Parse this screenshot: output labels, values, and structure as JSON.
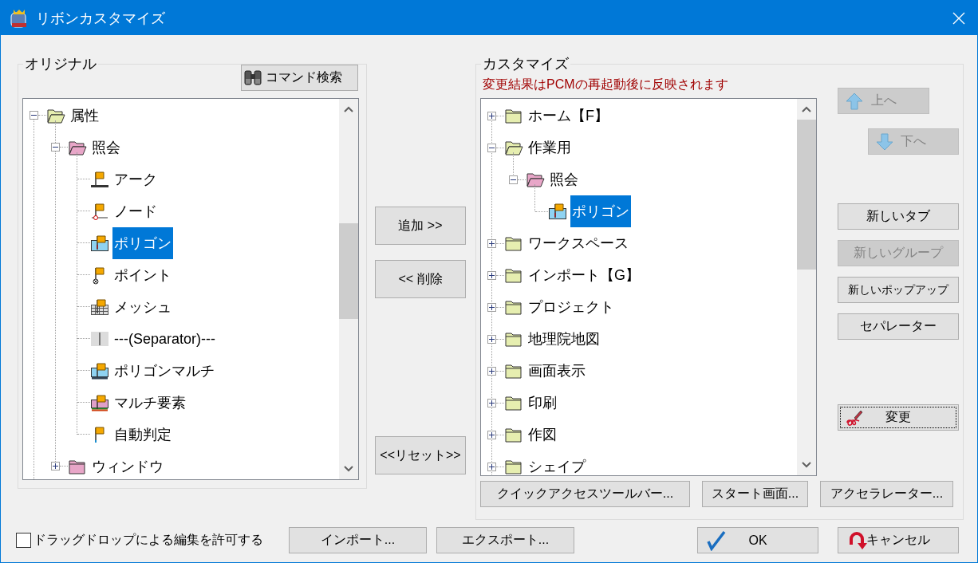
{
  "window": {
    "title": "リボンカスタマイズ"
  },
  "original": {
    "title": "オリジナル",
    "search_button": "コマンド検索",
    "tree": [
      {
        "label": "属性",
        "kind": "folder",
        "color": "#e6eeb0",
        "expanded": true,
        "selected": false,
        "children": [
          {
            "label": "照会",
            "kind": "folder",
            "color": "#e8a6c8",
            "expanded": true,
            "selected": false,
            "children": [
              {
                "label": "アーク",
                "kind": "arc",
                "selected": false
              },
              {
                "label": "ノード",
                "kind": "node",
                "selected": false
              },
              {
                "label": "ポリゴン",
                "kind": "polygon",
                "selected": true
              },
              {
                "label": "ポイント",
                "kind": "point",
                "selected": false
              },
              {
                "label": "メッシュ",
                "kind": "mesh",
                "selected": false
              },
              {
                "label": "---(Separator)---",
                "kind": "separator",
                "selected": false
              },
              {
                "label": "ポリゴンマルチ",
                "kind": "polygon-multi",
                "selected": false
              },
              {
                "label": "マルチ要素",
                "kind": "multi-element",
                "selected": false
              },
              {
                "label": "自動判定",
                "kind": "flag",
                "selected": false
              }
            ]
          },
          {
            "label": "ウィンドウ",
            "kind": "folder",
            "color": "#e8a6c8",
            "expanded": false,
            "selected": false
          }
        ]
      }
    ]
  },
  "transfer_buttons": [
    {
      "label": "追加 >>"
    },
    {
      "label": "<< 削除"
    },
    {
      "label": "<<リセット>>"
    }
  ],
  "customize": {
    "title": "カスタマイズ",
    "note": "変更結果はPCMの再起動後に反映されます",
    "tree": [
      {
        "label": "ホーム【F】",
        "kind": "folder",
        "color": "#e6eeb0",
        "expanded": false,
        "selected": false
      },
      {
        "label": "作業用",
        "kind": "folder",
        "color": "#e6eeb0",
        "expanded": true,
        "selected": false,
        "children": [
          {
            "label": "照会",
            "kind": "folder",
            "color": "#e8a6c8",
            "expanded": true,
            "selected": false,
            "children": [
              {
                "label": "ポリゴン",
                "kind": "polygon",
                "selected": true
              }
            ]
          }
        ]
      },
      {
        "label": "ワークスペース",
        "kind": "folder",
        "color": "#e6eeb0",
        "expanded": false,
        "selected": false
      },
      {
        "label": "インポート【G】",
        "kind": "folder",
        "color": "#e6eeb0",
        "expanded": false,
        "selected": false
      },
      {
        "label": "プロジェクト",
        "kind": "folder",
        "color": "#e6eeb0",
        "expanded": false,
        "selected": false
      },
      {
        "label": "地理院地図",
        "kind": "folder",
        "color": "#e6eeb0",
        "expanded": false,
        "selected": false
      },
      {
        "label": "画面表示",
        "kind": "folder",
        "color": "#e6eeb0",
        "expanded": false,
        "selected": false
      },
      {
        "label": "印刷",
        "kind": "folder",
        "color": "#e6eeb0",
        "expanded": false,
        "selected": false
      },
      {
        "label": "作図",
        "kind": "folder",
        "color": "#e6eeb0",
        "expanded": false,
        "selected": false
      },
      {
        "label": "シェイプ",
        "kind": "folder",
        "color": "#e6eeb0",
        "expanded": false,
        "selected": false
      }
    ],
    "side_buttons": [
      {
        "label": "上へ",
        "kind": "up",
        "disabled": true,
        "focused": false
      },
      {
        "label": "下へ",
        "kind": "down",
        "disabled": true,
        "focused": false
      },
      {
        "label": "新しいタブ",
        "kind": "plain",
        "disabled": false,
        "focused": false
      },
      {
        "label": "新しいグループ",
        "kind": "plain",
        "disabled": true,
        "focused": false
      },
      {
        "label": "新しいポップアップ",
        "kind": "plain",
        "disabled": false,
        "focused": false
      },
      {
        "label": "セパレーター",
        "kind": "plain",
        "disabled": false,
        "focused": false
      },
      {
        "label": "変更",
        "kind": "edit",
        "disabled": false,
        "focused": true
      }
    ],
    "bottom_buttons": [
      {
        "label": "クイックアクセスツールバー..."
      },
      {
        "label": "スタート画面..."
      },
      {
        "label": "アクセラレーター..."
      }
    ]
  },
  "allow_drag_drop": {
    "label": "ドラッグドロップによる編集を許可する",
    "checked": false
  },
  "footer_buttons": [
    {
      "label": "インポート...",
      "kind": "plain"
    },
    {
      "label": "エクスポート...",
      "kind": "plain"
    },
    {
      "label": "OK",
      "kind": "ok"
    },
    {
      "label": "キャンセル",
      "kind": "cancel"
    }
  ]
}
